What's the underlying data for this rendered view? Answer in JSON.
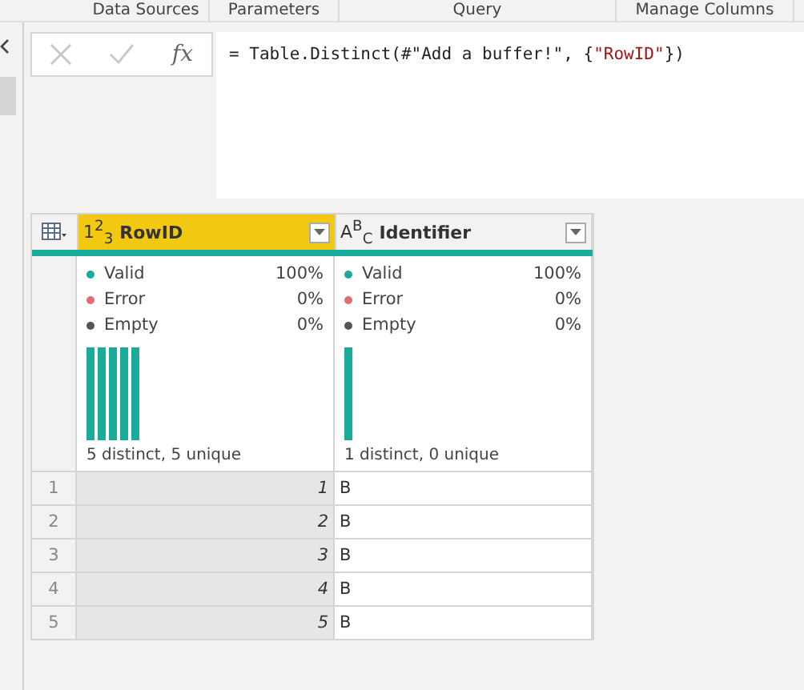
{
  "ribbon_groups": [
    {
      "label": "Data Sources"
    },
    {
      "label": "Parameters"
    },
    {
      "label": "Query"
    },
    {
      "label": "Manage Columns"
    }
  ],
  "formula_bar": {
    "fx": "fx",
    "cancel_disabled": true,
    "commit_disabled": true,
    "formula": [
      {
        "kind": "code",
        "text": "= Table.Distinct(#\"Add a buffer!\", {"
      },
      {
        "kind": "string",
        "text": "\"RowID\""
      },
      {
        "kind": "code",
        "text": "})"
      }
    ]
  },
  "table": {
    "columns": [
      {
        "type_label": "1$^{2}$$_{3}$",
        "name": "RowID",
        "selected": true,
        "quality": [
          {
            "label": "Valid",
            "value": "100%",
            "color": "#1aab9b"
          },
          {
            "label": "Error",
            "value": "0%",
            "color": "#e06c75"
          },
          {
            "label": "Empty",
            "value": "0%",
            "color": "#555555"
          }
        ],
        "summary": "5 distinct, 5 unique"
      },
      {
        "type_label": "A$^{B}$$_{C}$",
        "name": "Identifier",
        "selected": false,
        "quality": [
          {
            "label": "Valid",
            "value": "100%",
            "color": "#1aab9b"
          },
          {
            "label": "Error",
            "value": "0%",
            "color": "#e06c75"
          },
          {
            "label": "Empty",
            "value": "0%",
            "color": "#555555"
          }
        ],
        "summary": "1 distinct, 0 unique"
      }
    ],
    "rows": [
      {
        "number": "1",
        "cells": [
          "1",
          "B"
        ]
      },
      {
        "number": "2",
        "cells": [
          "2",
          "B"
        ]
      },
      {
        "number": "3",
        "cells": [
          "3",
          "B"
        ]
      },
      {
        "number": "4",
        "cells": [
          "4",
          "B"
        ]
      },
      {
        "number": "5",
        "cells": [
          "5",
          "B"
        ]
      }
    ]
  }
}
